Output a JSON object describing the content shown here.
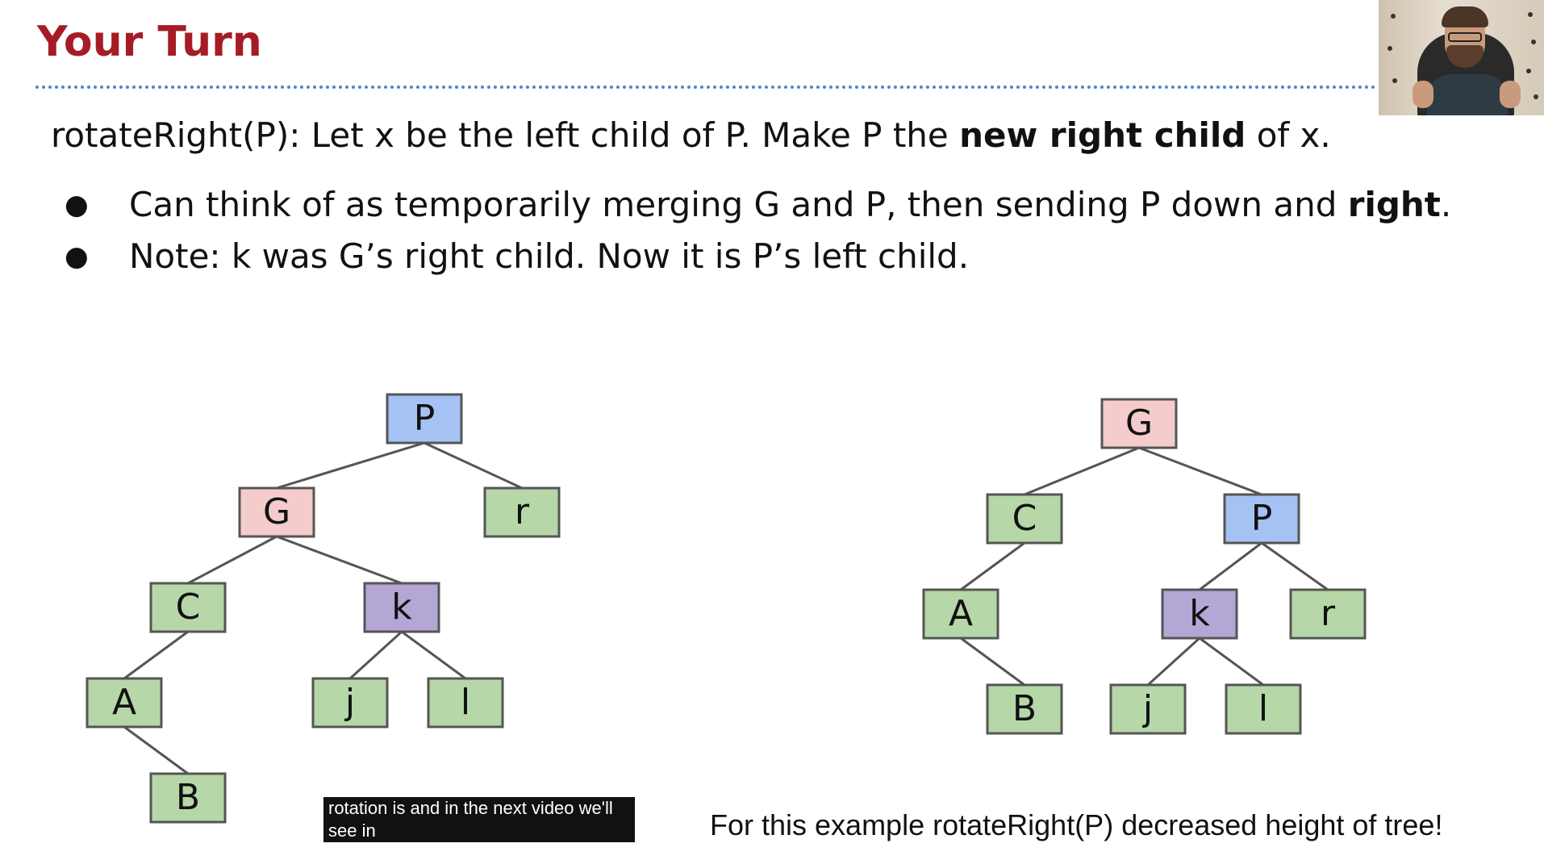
{
  "slide": {
    "title": "Your Turn",
    "main_line": {
      "prefix": "rotateRight(P): Let x be the left child of P. Make P the ",
      "bold": "new right child",
      "suffix": " of x."
    },
    "bullets": [
      {
        "marker": "●",
        "text": "Can think of as temporarily merging G and P, then sending P down and ",
        "bold": "right",
        "suffix": "."
      },
      {
        "marker": "●",
        "text": "Note: k was G’s right child. Now it is P’s left child.",
        "bold": "",
        "suffix": ""
      }
    ],
    "note": "For this example rotateRight(P) decreased height of tree!"
  },
  "caption": {
    "line1": "rotation is and in the next video we'll",
    "line2": "see in"
  },
  "colors": {
    "title": "#a61c25",
    "dotted_rule": "#4a86c5",
    "blue_node": "#a4c2f4",
    "pink_node": "#f4cccc",
    "green_node": "#b6d7a8",
    "purple_node": "#b4a7d6",
    "edge": "#555555"
  },
  "trees": {
    "before": {
      "nodes": [
        {
          "id": "P",
          "label": "P",
          "color": "blue"
        },
        {
          "id": "G",
          "label": "G",
          "color": "pink"
        },
        {
          "id": "r",
          "label": "r",
          "color": "green"
        },
        {
          "id": "C",
          "label": "C",
          "color": "green"
        },
        {
          "id": "k",
          "label": "k",
          "color": "purple"
        },
        {
          "id": "A",
          "label": "A",
          "color": "green"
        },
        {
          "id": "j",
          "label": "j",
          "color": "green"
        },
        {
          "id": "l",
          "label": "l",
          "color": "green"
        },
        {
          "id": "B",
          "label": "B",
          "color": "green"
        }
      ],
      "edges": [
        [
          "P",
          "G"
        ],
        [
          "P",
          "r"
        ],
        [
          "G",
          "C"
        ],
        [
          "G",
          "k"
        ],
        [
          "C",
          "A"
        ],
        [
          "k",
          "j"
        ],
        [
          "k",
          "l"
        ],
        [
          "A",
          "B"
        ]
      ]
    },
    "after": {
      "nodes": [
        {
          "id": "G",
          "label": "G",
          "color": "pink"
        },
        {
          "id": "C",
          "label": "C",
          "color": "green"
        },
        {
          "id": "P",
          "label": "P",
          "color": "blue"
        },
        {
          "id": "A",
          "label": "A",
          "color": "green"
        },
        {
          "id": "k",
          "label": "k",
          "color": "purple"
        },
        {
          "id": "r",
          "label": "r",
          "color": "green"
        },
        {
          "id": "B",
          "label": "B",
          "color": "green"
        },
        {
          "id": "j",
          "label": "j",
          "color": "green"
        },
        {
          "id": "l",
          "label": "l",
          "color": "green"
        }
      ],
      "edges": [
        [
          "G",
          "C"
        ],
        [
          "G",
          "P"
        ],
        [
          "C",
          "A"
        ],
        [
          "P",
          "k"
        ],
        [
          "P",
          "r"
        ],
        [
          "A",
          "B"
        ],
        [
          "k",
          "j"
        ],
        [
          "k",
          "l"
        ]
      ]
    }
  }
}
